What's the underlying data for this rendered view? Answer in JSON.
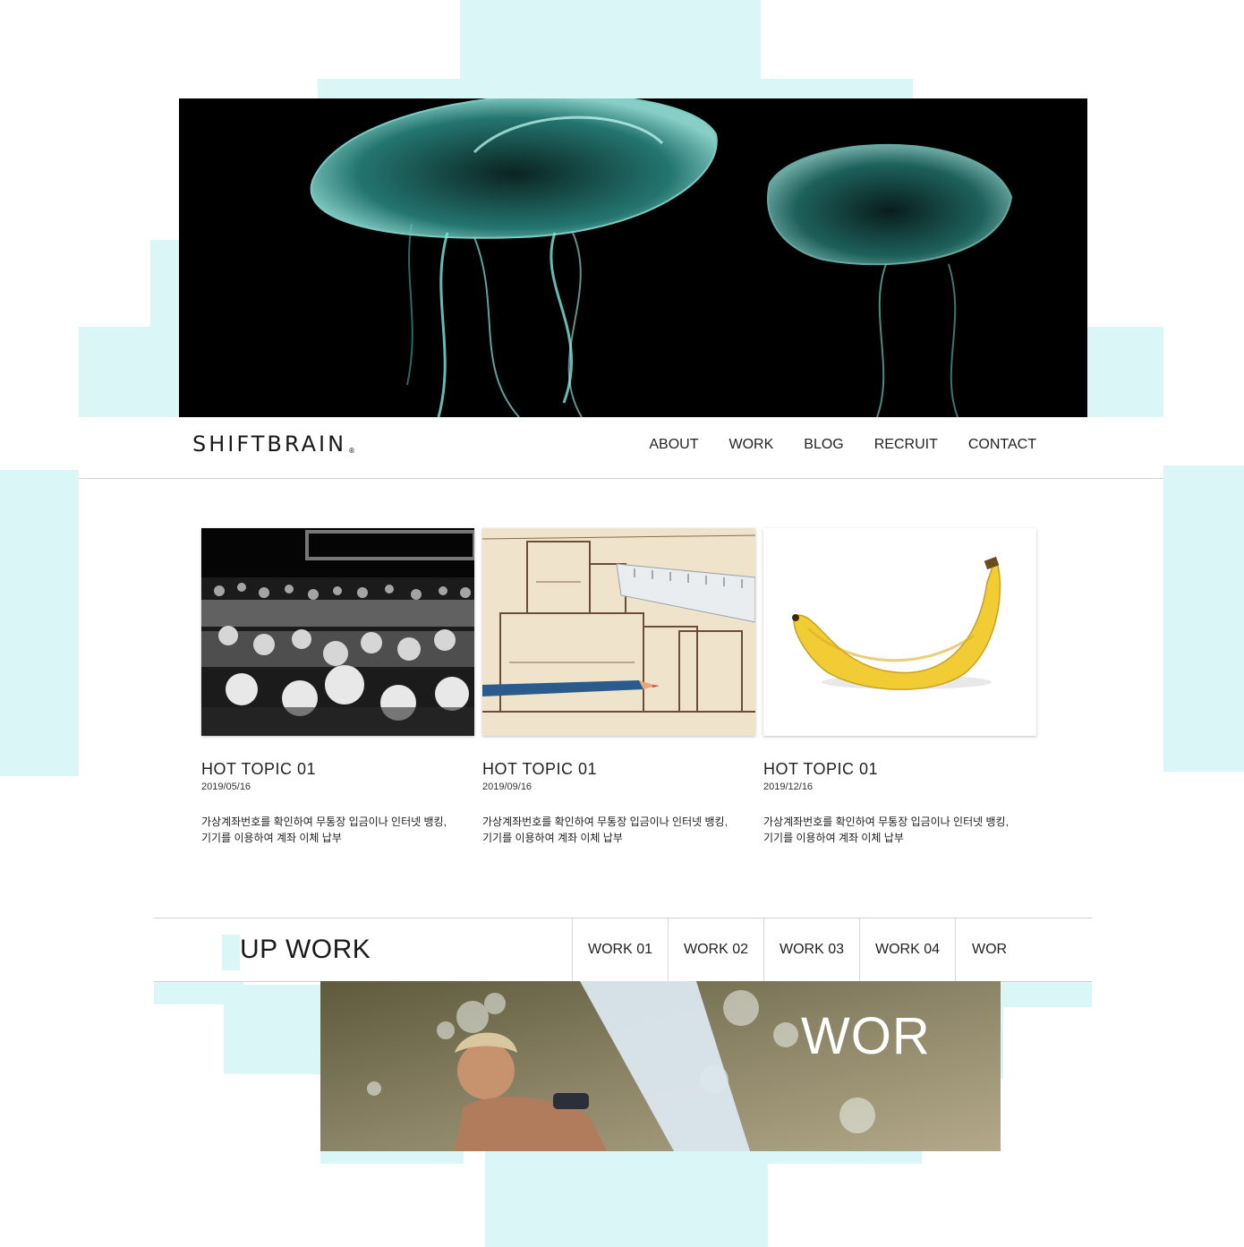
{
  "header": {
    "logo_text": "SHIFTBRAIN",
    "logo_mark": "®",
    "nav": [
      "ABOUT",
      "WORK",
      "BLOG",
      "RECRUIT",
      "CONTACT"
    ]
  },
  "topics": [
    {
      "title": "HOT TOPIC 01",
      "date": "2019/05/16",
      "desc_line1": "가상계좌번호를 확인하여 무통장 입금이나 인터넷 뱅킹,",
      "desc_line2": "기기를 이용하여 계좌 이체 납부",
      "image": "concert-crowd"
    },
    {
      "title": "HOT TOPIC 01",
      "date": "2019/09/16",
      "desc_line1": "가상계좌번호를 확인하여 무통장 입금이나 인터넷 뱅킹,",
      "desc_line2": "기기를 이용하여 계좌 이체 납부",
      "image": "blueprint-with-ruler-and-pencil"
    },
    {
      "title": "HOT TOPIC 01",
      "date": "2019/12/16",
      "desc_line1": "가상계좌번호를 확인하여 무통장 입금이나 인터넷 뱅킹,",
      "desc_line2": "기기를 이용하여 계좌 이체 납부",
      "image": "banana"
    }
  ],
  "pickup": {
    "title": "UP WORK",
    "tabs": [
      "WORK 01",
      "WORK 02",
      "WORK 03",
      "WORK 04",
      "WOR"
    ]
  },
  "work_banner": {
    "text": "WOR"
  },
  "colors": {
    "frame": "#dbf6f6",
    "jellyfish": "#7fe8df",
    "hero_bg": "#000000"
  }
}
